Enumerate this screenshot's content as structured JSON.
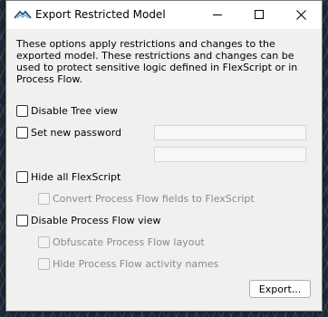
{
  "window": {
    "title": "Export Restricted Model",
    "controls": {
      "minimize": "minimize-icon",
      "maximize": "maximize-icon",
      "close": "close-icon"
    }
  },
  "description": "These options apply restrictions and changes to the exported model. These restrictions and changes can be used to protect sensitive logic defined in FlexScript or in Process Flow.",
  "options": {
    "disable_tree_view": {
      "label": "Disable Tree view",
      "checked": false
    },
    "set_new_password": {
      "label": "Set new password",
      "checked": false
    },
    "hide_all_flexscript": {
      "label": "Hide all FlexScript",
      "checked": false
    },
    "convert_process_flow_fields": {
      "label": "Convert Process Flow fields to FlexScript",
      "checked": false,
      "enabled": false
    },
    "disable_process_flow_view": {
      "label": "Disable Process Flow view",
      "checked": false
    },
    "obfuscate_process_flow_layout": {
      "label": "Obfuscate Process Flow layout",
      "checked": false,
      "enabled": false
    },
    "hide_process_flow_activity_names": {
      "label": "Hide Process Flow activity names",
      "checked": false,
      "enabled": false
    }
  },
  "password": {
    "field_value": "",
    "confirm_value": ""
  },
  "buttons": {
    "export_label": "Export..."
  },
  "colors": {
    "dialog_bg": "#f0f0f0",
    "titlebar_bg": "#ffffff",
    "disabled_text": "#8a8a8a"
  }
}
